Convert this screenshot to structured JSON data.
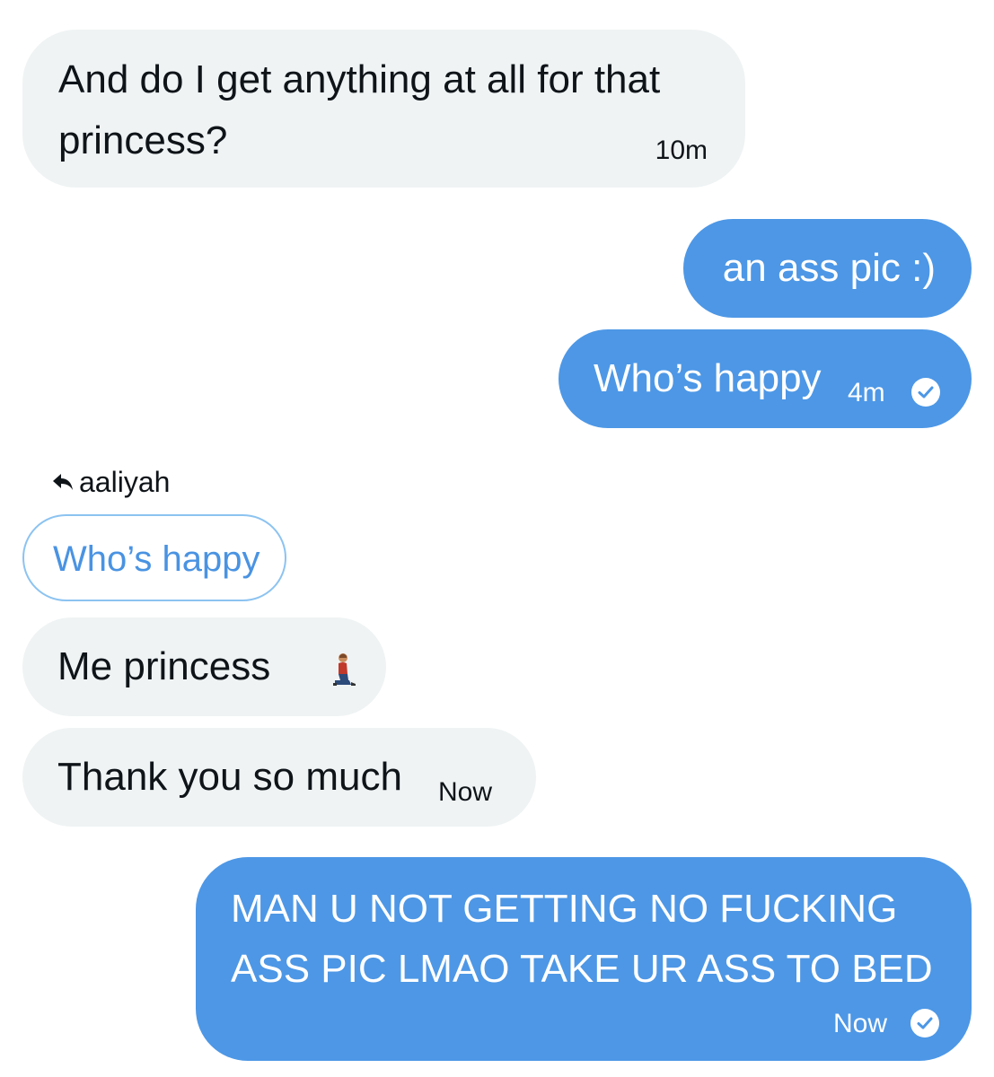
{
  "colors": {
    "incoming_bubble": "#eff3f4",
    "outgoing_bubble": "#4d97e6",
    "quoted_border": "#8cc3f1",
    "quoted_text": "#4a93e2",
    "text_dark": "#0f1419"
  },
  "messages": [
    {
      "direction": "incoming",
      "text": "And do I get anything at all for that princess?",
      "timestamp": "10m"
    },
    {
      "direction": "outgoing",
      "text": "an ass pic :)"
    },
    {
      "direction": "outgoing",
      "text": "Who’s happy",
      "timestamp": "4m",
      "status_icon": "check-circle-icon"
    },
    {
      "direction": "incoming",
      "text": "Me princess",
      "emoji": "person-kneeling-icon"
    },
    {
      "direction": "incoming",
      "text": "Thank you so much",
      "timestamp": "Now"
    },
    {
      "direction": "outgoing",
      "text": "MAN U NOT GETTING NO FUCKING ASS PIC LMAO TAKE UR ASS TO BED",
      "timestamp": "Now",
      "status_icon": "check-circle-icon"
    }
  ],
  "reply": {
    "icon": "reply-arrow-icon",
    "to_user": "aaliyah",
    "quoted_text": "Who’s happy"
  }
}
